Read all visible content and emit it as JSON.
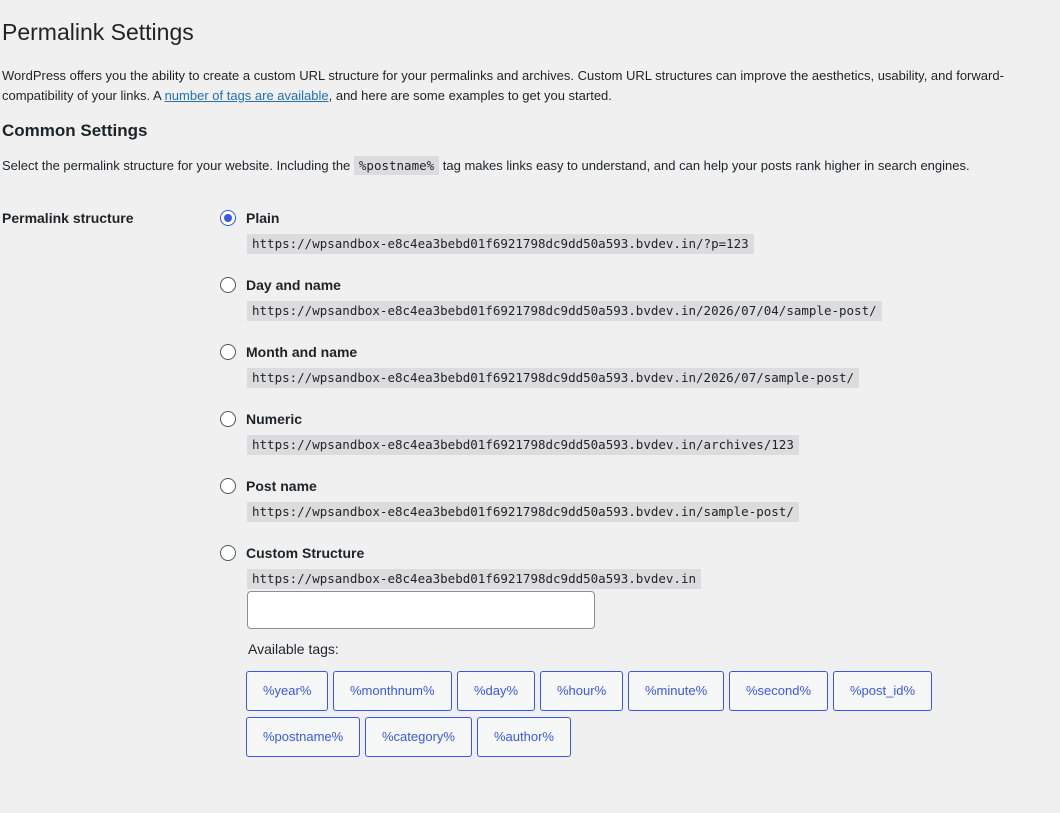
{
  "page_title": "Permalink Settings",
  "intro": {
    "text_before": "WordPress offers you the ability to create a custom URL structure for your permalinks and archives. Custom URL structures can improve the aesthetics, usability, and forward-compatibility of your links. A ",
    "link": "number of tags are available",
    "text_after": ", and here are some examples to get you started."
  },
  "common": {
    "heading": "Common Settings",
    "text_before": "Select the permalink structure for your website. Including the ",
    "code": "%postname%",
    "text_after": " tag makes links easy to understand, and can help your posts rank higher in search engines."
  },
  "permalink_structure_label": "Permalink structure",
  "options": [
    {
      "label": "Plain",
      "url": "https://wpsandbox-e8c4ea3bebd01f6921798dc9dd50a593.bvdev.in/?p=123",
      "checked": true
    },
    {
      "label": "Day and name",
      "url": "https://wpsandbox-e8c4ea3bebd01f6921798dc9dd50a593.bvdev.in/2026/07/04/sample-post/",
      "checked": false
    },
    {
      "label": "Month and name",
      "url": "https://wpsandbox-e8c4ea3bebd01f6921798dc9dd50a593.bvdev.in/2026/07/sample-post/",
      "checked": false
    },
    {
      "label": "Numeric",
      "url": "https://wpsandbox-e8c4ea3bebd01f6921798dc9dd50a593.bvdev.in/archives/123",
      "checked": false
    },
    {
      "label": "Post name",
      "url": "https://wpsandbox-e8c4ea3bebd01f6921798dc9dd50a593.bvdev.in/sample-post/",
      "checked": false
    },
    {
      "label": "Custom Structure",
      "url": "https://wpsandbox-e8c4ea3bebd01f6921798dc9dd50a593.bvdev.in",
      "checked": false
    }
  ],
  "custom_structure_value": "",
  "available_tags_label": "Available tags:",
  "tags": [
    "%year%",
    "%monthnum%",
    "%day%",
    "%hour%",
    "%minute%",
    "%second%",
    "%post_id%",
    "%postname%",
    "%category%",
    "%author%"
  ],
  "colors": {
    "accent": "#3858e9",
    "link": "#2271b1",
    "background": "#f0f0f1",
    "code_bg": "#dcdcde"
  }
}
